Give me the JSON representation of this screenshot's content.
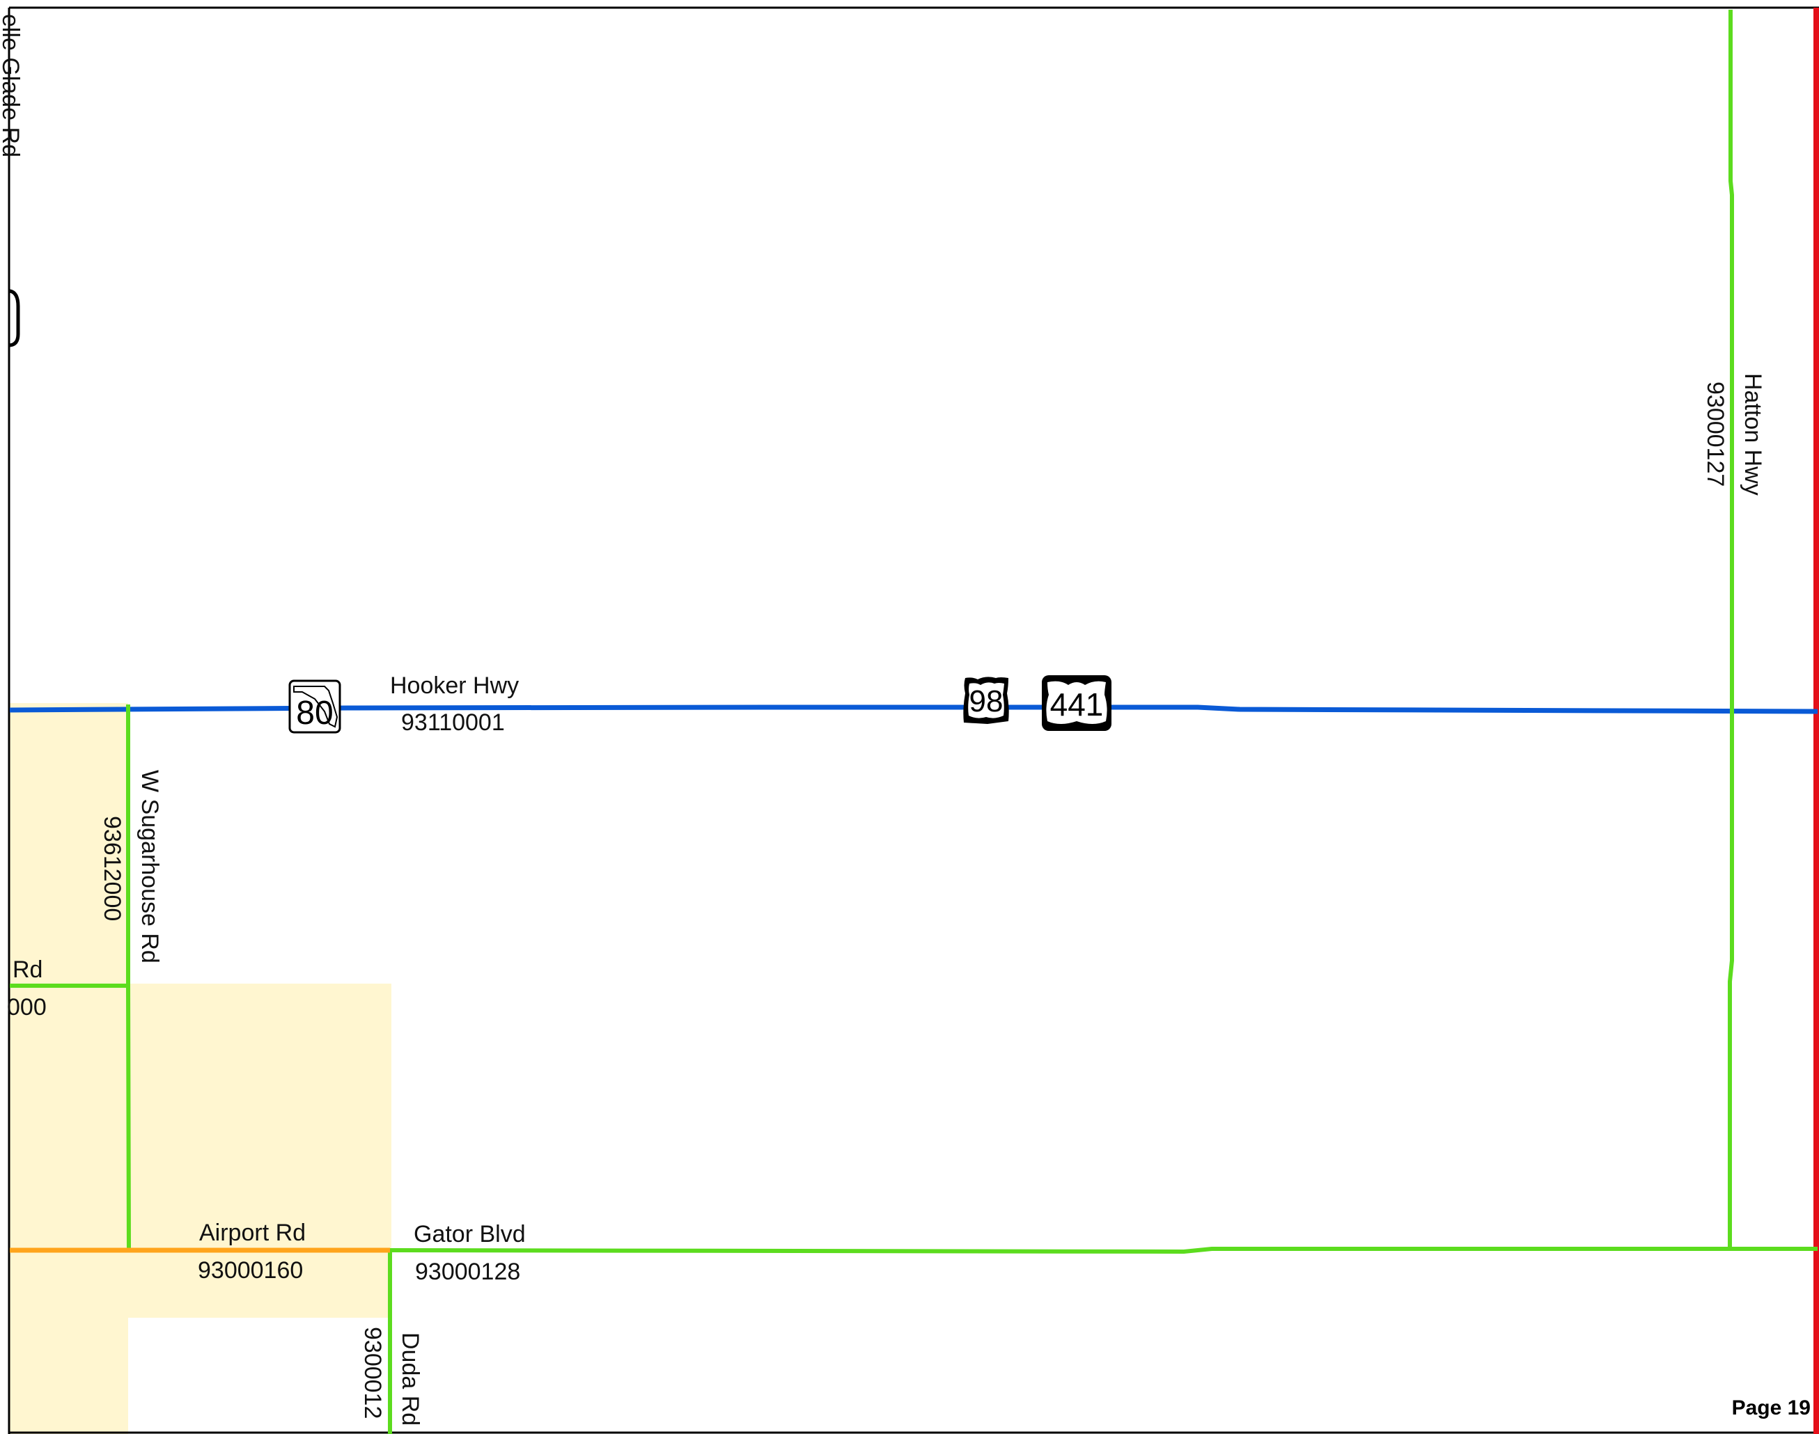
{
  "colors": {
    "background": "#ffffff",
    "urban_area": "#fff6d0",
    "state_highway": "#0a5ad6",
    "local_road": "#5cdc1e",
    "airport_road": "#ffa41c",
    "map_edge": "#e4101a",
    "frame": "#000000"
  },
  "page": {
    "label": "Page 19"
  },
  "cut_labels": {
    "top_left": "elle Glade Rd",
    "left_road_name": "Rd",
    "left_road_id": "000"
  },
  "roads": {
    "hooker_hwy": {
      "name": "Hooker Hwy",
      "id": "93110001"
    },
    "hatton_hwy": {
      "name": "Hatton Hwy",
      "id": "93000127"
    },
    "w_sugarhouse_rd": {
      "name": "W Sugarhouse Rd",
      "id": "93612000"
    },
    "airport_rd": {
      "name": "Airport Rd",
      "id": "93000160"
    },
    "gator_blvd": {
      "name": "Gator Blvd",
      "id": "93000128"
    },
    "duda_rd": {
      "name": "Duda Rd",
      "id": "9300012"
    }
  },
  "shields": {
    "state_route": {
      "number": "80",
      "icon": "florida-state-road-shield"
    },
    "us_route_a": {
      "number": "98",
      "icon": "us-highway-shield"
    },
    "us_route_b": {
      "number": "441",
      "icon": "us-highway-shield"
    }
  }
}
